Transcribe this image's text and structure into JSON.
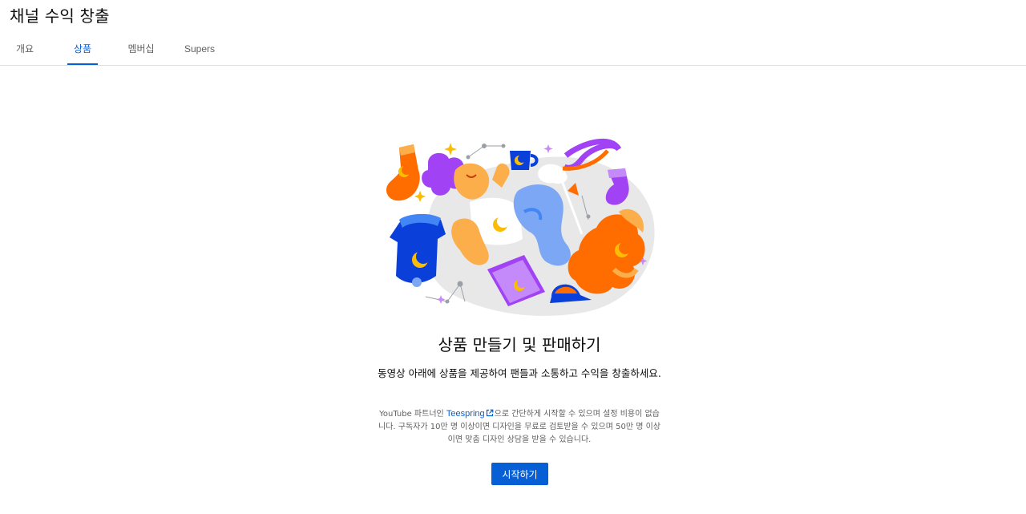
{
  "page": {
    "title": "채널 수익 창출"
  },
  "tabs": [
    {
      "label": "개요",
      "active": false
    },
    {
      "label": "상품",
      "active": true
    },
    {
      "label": "멤버십",
      "active": false
    },
    {
      "label": "Supers",
      "active": false
    }
  ],
  "content": {
    "heading": "상품 만들기 및 판매하기",
    "description": "동영상 아래에 상품을 제공하여 팬들과 소통하고 수익을 창출하세요.",
    "note_prefix": "YouTube 파트너인 ",
    "note_link": "Teespring",
    "note_suffix": "으로 간단하게 시작할 수 있으며 설정 비용이 없습니다. 구독자가 10만 명 이상이면 디자인을 무료로 검토받을 수 있으며 50만 명 이상이면 맞춤 디자인 상담을 받을 수 있습니다.",
    "start_button": "시작하기"
  },
  "colors": {
    "accent": "#065fd4",
    "orange": "#ff6d00",
    "purple": "#a142f4",
    "blue": "#0b3fd9",
    "light_blue": "#7ba7f5",
    "yellow": "#fbbc04",
    "peach": "#fbae4a"
  },
  "icons": {
    "external_link": "external-link-icon"
  }
}
